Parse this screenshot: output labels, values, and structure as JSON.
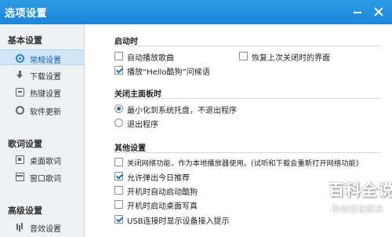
{
  "window": {
    "title": "选项设置"
  },
  "sidebar": {
    "groups": [
      {
        "label": "基本设置",
        "items": [
          {
            "label": "常规设置",
            "icon": "gear-icon",
            "selected": true
          },
          {
            "label": "下载设置",
            "icon": "download-icon"
          },
          {
            "label": "热键设置",
            "icon": "hotkey-icon"
          },
          {
            "label": "软件更新",
            "icon": "update-icon"
          }
        ]
      },
      {
        "label": "歌词设置",
        "items": [
          {
            "label": "桌面歌词",
            "icon": "desktop-lyrics-icon"
          },
          {
            "label": "窗口歌词",
            "icon": "window-lyrics-icon"
          }
        ]
      },
      {
        "label": "高级设置",
        "items": [
          {
            "label": "音效设置",
            "icon": "sound-effect-icon"
          }
        ]
      }
    ]
  },
  "main": {
    "startup": {
      "title": "启动时",
      "auto_play": {
        "label": "自动播放歌曲",
        "checked": false
      },
      "restore_ui": {
        "label": "恢复上次关闭时的界面",
        "checked": false
      },
      "play_greeting": {
        "label": "播放“Hello酷狗”问候语",
        "checked": true
      }
    },
    "close_panel": {
      "title": "关闭主面板时",
      "minimize": {
        "label": "最小化到系统托盘，不退出程序",
        "selected": true
      },
      "exit": {
        "label": "退出程序",
        "selected": false
      }
    },
    "other": {
      "title": "其他设置",
      "network": {
        "label": "关闭网络功能，作为本地播放器使用。(试听和下载会重新打开网络功能)",
        "checked": false
      },
      "popup": {
        "label": "允许弹出今日推荐",
        "checked": true
      },
      "autostart": {
        "label": "开机时自动启动酷狗",
        "checked": false
      },
      "desktop_photo": {
        "label": "开机时启动桌面写真",
        "checked": false
      },
      "usb_prompt": {
        "label": "USB连接时显示设备接入提示",
        "checked": true
      }
    }
  },
  "watermark": {
    "main": "百科全说",
    "sub": "助你轻松解决"
  },
  "colors": {
    "titlebar": "#1c86d8",
    "sidebar_bg": "#eef1f4",
    "selected_bg": "#d0e6f7",
    "accent": "#1f6fc1"
  }
}
